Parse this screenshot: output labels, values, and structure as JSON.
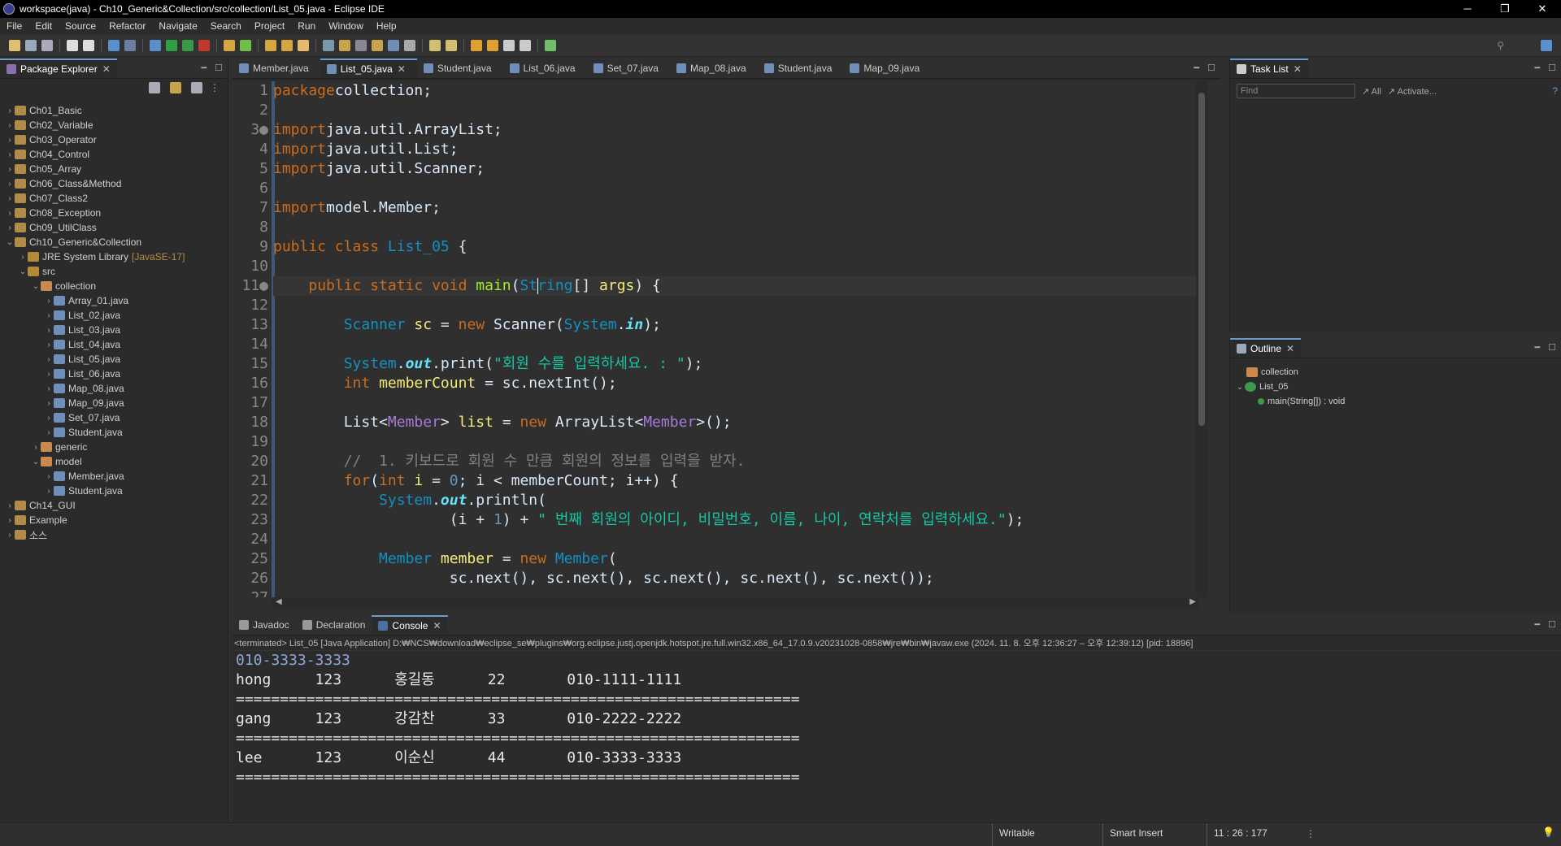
{
  "window": {
    "title": "workspace(java) - Ch10_Generic&Collection/src/collection/List_05.java - Eclipse IDE",
    "controls": [
      "─",
      "❐",
      "✕"
    ]
  },
  "menu": [
    "File",
    "Edit",
    "Source",
    "Refactor",
    "Navigate",
    "Search",
    "Project",
    "Run",
    "Window",
    "Help"
  ],
  "package_explorer": {
    "tab_label": "Package Explorer",
    "items": [
      {
        "label": "Ch01_Basic",
        "type": "proj",
        "depth": 0,
        "tw": "›"
      },
      {
        "label": "Ch02_Variable",
        "type": "proj",
        "depth": 0,
        "tw": "›"
      },
      {
        "label": "Ch03_Operator",
        "type": "proj",
        "depth": 0,
        "tw": "›"
      },
      {
        "label": "Ch04_Control",
        "type": "proj",
        "depth": 0,
        "tw": "›"
      },
      {
        "label": "Ch05_Array",
        "type": "proj",
        "depth": 0,
        "tw": "›"
      },
      {
        "label": "Ch06_Class&Method",
        "type": "proj",
        "depth": 0,
        "tw": "›"
      },
      {
        "label": "Ch07_Class2",
        "type": "proj",
        "depth": 0,
        "tw": "›"
      },
      {
        "label": "Ch08_Exception",
        "type": "proj",
        "depth": 0,
        "tw": "›"
      },
      {
        "label": "Ch09_UtilClass",
        "type": "proj",
        "depth": 0,
        "tw": "›"
      },
      {
        "label": "Ch10_Generic&Collection",
        "type": "proj",
        "depth": 0,
        "tw": "⌄"
      },
      {
        "label": "JRE System Library",
        "suffix": "[JavaSE-17]",
        "type": "lib",
        "depth": 1,
        "tw": "›"
      },
      {
        "label": "src",
        "type": "lib",
        "depth": 1,
        "tw": "⌄"
      },
      {
        "label": "collection",
        "type": "pkg",
        "depth": 2,
        "tw": "⌄"
      },
      {
        "label": "Array_01.java",
        "type": "file",
        "depth": 3,
        "tw": "›"
      },
      {
        "label": "List_02.java",
        "type": "file",
        "depth": 3,
        "tw": "›"
      },
      {
        "label": "List_03.java",
        "type": "file",
        "depth": 3,
        "tw": "›"
      },
      {
        "label": "List_04.java",
        "type": "file",
        "depth": 3,
        "tw": "›"
      },
      {
        "label": "List_05.java",
        "type": "file",
        "depth": 3,
        "tw": "›"
      },
      {
        "label": "List_06.java",
        "type": "file",
        "depth": 3,
        "tw": "›"
      },
      {
        "label": "Map_08.java",
        "type": "file",
        "depth": 3,
        "tw": "›"
      },
      {
        "label": "Map_09.java",
        "type": "file",
        "depth": 3,
        "tw": "›"
      },
      {
        "label": "Set_07.java",
        "type": "file",
        "depth": 3,
        "tw": "›"
      },
      {
        "label": "Student.java",
        "type": "file",
        "depth": 3,
        "tw": "›"
      },
      {
        "label": "generic",
        "type": "pkg",
        "depth": 2,
        "tw": "›"
      },
      {
        "label": "model",
        "type": "pkg",
        "depth": 2,
        "tw": "⌄"
      },
      {
        "label": "Member.java",
        "type": "file",
        "depth": 3,
        "tw": "›"
      },
      {
        "label": "Student.java",
        "type": "file",
        "depth": 3,
        "tw": "›"
      },
      {
        "label": "Ch14_GUI",
        "type": "proj",
        "depth": 0,
        "tw": "›"
      },
      {
        "label": "Example",
        "type": "proj",
        "depth": 0,
        "tw": "›"
      },
      {
        "label": "소스",
        "type": "proj",
        "depth": 0,
        "tw": "›"
      }
    ]
  },
  "editor_tabs": [
    {
      "label": "Member.java",
      "active": false
    },
    {
      "label": "List_05.java",
      "active": true
    },
    {
      "label": "Student.java",
      "active": false
    },
    {
      "label": "List_06.java",
      "active": false
    },
    {
      "label": "Set_07.java",
      "active": false
    },
    {
      "label": "Map_08.java",
      "active": false
    },
    {
      "label": "Student.java",
      "active": false
    },
    {
      "label": "Map_09.java",
      "active": false
    }
  ],
  "code": {
    "line_numbers": [
      "1",
      "2",
      "3●",
      "4",
      "5",
      "6",
      "7",
      "8",
      "9",
      "10",
      "11●",
      "12",
      "13",
      "14",
      "15",
      "16",
      "17",
      "18",
      "19",
      "20",
      "21",
      "22",
      "23",
      "24",
      "25",
      "26",
      "27"
    ],
    "current_line": 11,
    "lines": [
      [
        [
          "kw",
          "package"
        ],
        [
          "",
          "collection;"
        ]
      ],
      [],
      [
        [
          "kw",
          "import"
        ],
        [
          "",
          "java.util.ArrayList;"
        ]
      ],
      [
        [
          "kw",
          "import"
        ],
        [
          "",
          "java.util.List;"
        ]
      ],
      [
        [
          "kw",
          "import"
        ],
        [
          "",
          "java.util.Scanner;"
        ]
      ],
      [],
      [
        [
          "kw",
          "import"
        ],
        [
          "",
          "model.Member;"
        ]
      ],
      [],
      [
        [
          "kw",
          "public class "
        ],
        [
          "cls",
          "List_05"
        ],
        [
          "",
          " {"
        ]
      ],
      [],
      [
        [
          "",
          "    "
        ],
        [
          "kw",
          "public static void "
        ],
        [
          "meth",
          "main"
        ],
        [
          "",
          "("
        ],
        [
          "cls",
          "String"
        ],
        [
          "",
          "[] "
        ],
        [
          "var",
          "args"
        ],
        [
          "",
          ") {"
        ]
      ],
      [],
      [
        [
          "",
          "        "
        ],
        [
          "cls",
          "Scanner "
        ],
        [
          "var",
          "sc"
        ],
        [
          "",
          " = "
        ],
        [
          "kw",
          "new "
        ],
        [
          "",
          "Scanner("
        ],
        [
          "cls",
          "System"
        ],
        [
          "",
          "."
        ],
        [
          "fld",
          "in"
        ],
        [
          "",
          ");"
        ]
      ],
      [],
      [
        [
          "",
          "        "
        ],
        [
          "cls",
          "System"
        ],
        [
          "",
          "."
        ],
        [
          "fld",
          "out"
        ],
        [
          "",
          ".print("
        ],
        [
          "str",
          "\"회원 수를 입력하세요. : \""
        ],
        [
          "",
          ");"
        ]
      ],
      [
        [
          "",
          "        "
        ],
        [
          "kw",
          "int "
        ],
        [
          "var",
          "memberCount"
        ],
        [
          "",
          " = sc.nextInt();"
        ]
      ],
      [],
      [
        [
          "",
          "        List<"
        ],
        [
          "typ",
          "Member"
        ],
        [
          "",
          "> "
        ],
        [
          "var",
          "list"
        ],
        [
          "",
          " = "
        ],
        [
          "kw",
          "new "
        ],
        [
          "",
          "ArrayList<"
        ],
        [
          "typ",
          "Member"
        ],
        [
          "",
          ">();"
        ]
      ],
      [],
      [
        [
          "",
          "        "
        ],
        [
          "cmt",
          "//  1. 키보드로 회원 수 만큼 회원의 정보를 입력을 받자."
        ]
      ],
      [
        [
          "",
          "        "
        ],
        [
          "kw",
          "for"
        ],
        [
          "",
          "("
        ],
        [
          "kw",
          "int "
        ],
        [
          "var",
          "i"
        ],
        [
          "",
          " = "
        ],
        [
          "num",
          "0"
        ],
        [
          "",
          "; i < memberCount; i++) {"
        ]
      ],
      [
        [
          "",
          "            "
        ],
        [
          "cls",
          "System"
        ],
        [
          "",
          "."
        ],
        [
          "fld",
          "out"
        ],
        [
          "",
          ".println("
        ]
      ],
      [
        [
          "",
          "                    (i + "
        ],
        [
          "num",
          "1"
        ],
        [
          "",
          ") + "
        ],
        [
          "str",
          "\" 번째 회원의 아이디, 비밀번호, 이름, 나이, 연락처를 입력하세요.\""
        ],
        [
          "",
          ");"
        ]
      ],
      [],
      [
        [
          "",
          "            "
        ],
        [
          "cls",
          "Member "
        ],
        [
          "var",
          "member"
        ],
        [
          "",
          " = "
        ],
        [
          "kw",
          "new "
        ],
        [
          "cls",
          "Member"
        ],
        [
          "",
          "("
        ]
      ],
      [
        [
          "",
          "                    sc.next(), sc.next(), sc.next(), sc.next(), sc.next());"
        ]
      ],
      [
        [
          "",
          ""
        ]
      ]
    ]
  },
  "task_list": {
    "tab_label": "Task List",
    "find_placeholder": "Find",
    "all_label": "All",
    "activate_label": "Activate..."
  },
  "outline": {
    "tab_label": "Outline",
    "items": [
      {
        "label": "collection",
        "depth": 0
      },
      {
        "label": "List_05",
        "depth": 0
      },
      {
        "label": "main(String[]) : void",
        "depth": 1
      }
    ]
  },
  "bottom_tabs": [
    {
      "label": "Javadoc",
      "active": false
    },
    {
      "label": "Declaration",
      "active": false
    },
    {
      "label": "Console",
      "active": true
    }
  ],
  "console": {
    "header": "<terminated> List_05 [Java Application] D:₩NCS₩download₩eclipse_se₩plugins₩org.eclipse.justj.openjdk.hotspot.jre.full.win32.x86_64_17.0.9.v20231028-0858₩jre₩bin₩javaw.exe  (2024. 11. 8. 오후 12:36:27 – 오후 12:39:12) [pid: 18896]",
    "lines": [
      "010-3333-3333",
      "hong     123      홍길동      22       010-1111-1111",
      "================================================================",
      "gang     123      강감찬      33       010-2222-2222",
      "================================================================",
      "lee      123      이순신      44       010-3333-3333",
      "================================================================"
    ]
  },
  "status": {
    "writable": "Writable",
    "insert_mode": "Smart Insert",
    "position": "11 : 26 : 177"
  }
}
